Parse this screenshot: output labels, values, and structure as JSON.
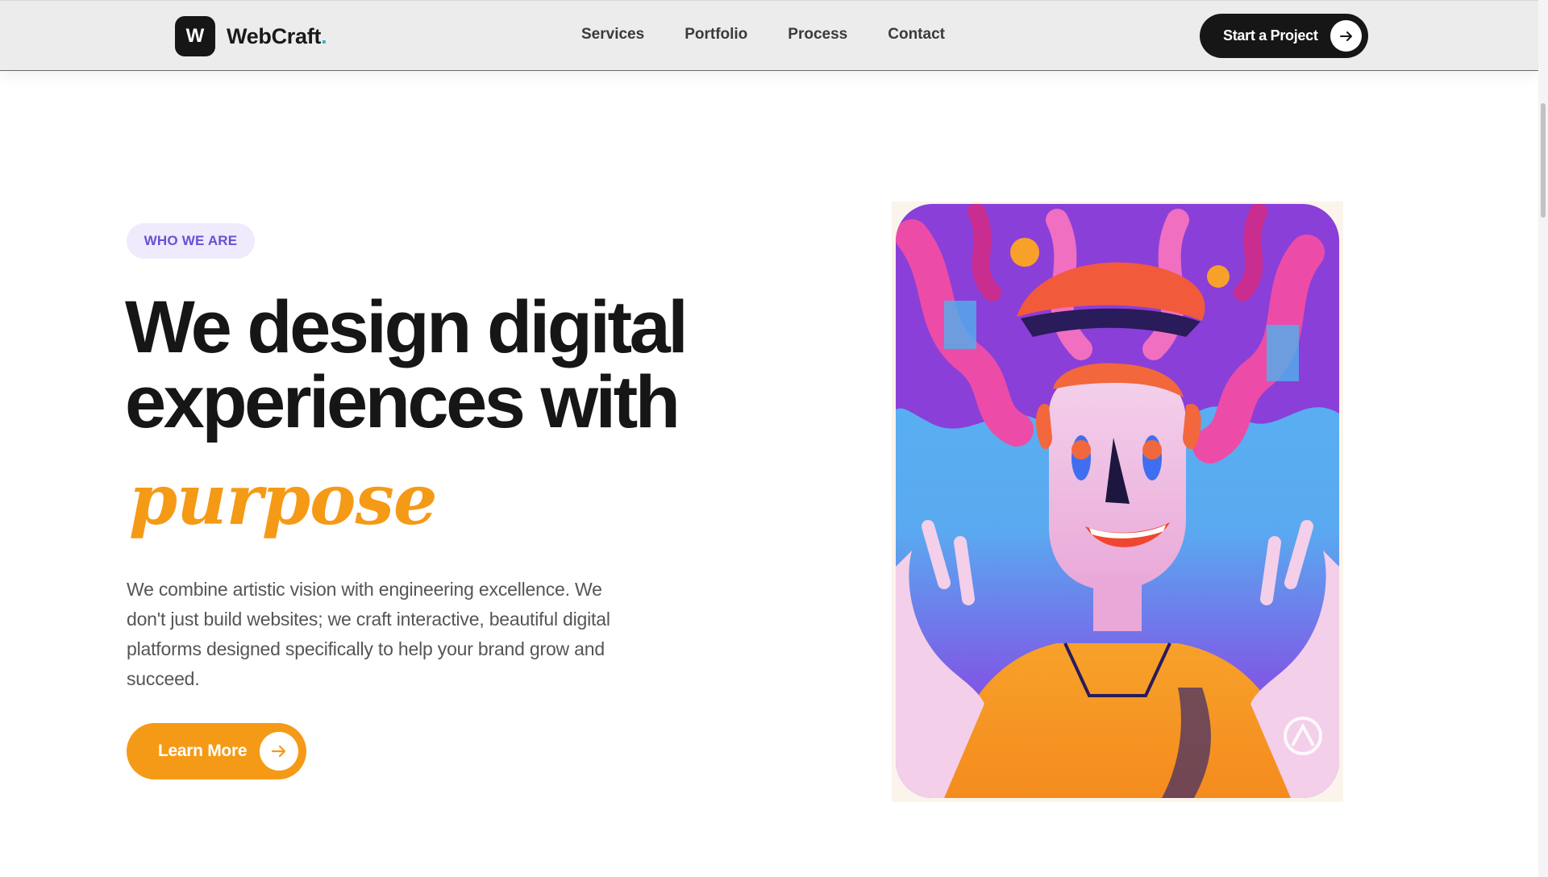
{
  "header": {
    "logo_mark": "W",
    "logo_text": "WebCraft",
    "logo_dot": ".",
    "nav": [
      {
        "label": "Services"
      },
      {
        "label": "Portfolio"
      },
      {
        "label": "Process"
      },
      {
        "label": "Contact"
      }
    ],
    "cta_label": "Start a Project",
    "cta_icon": "arrow-right-icon"
  },
  "hero": {
    "eyebrow": "WHO WE ARE",
    "headline_line1": "We design digital",
    "headline_line2": "experiences with",
    "accent_word": "purpose",
    "body": "We combine artistic vision with engineering excellence. We don't just build websites; we craft interactive, beautiful digital platforms designed specifically to help your brand grow and succeed.",
    "button_label": "Learn More",
    "button_icon": "arrow-right-icon"
  },
  "colors": {
    "accent_orange": "#f59a16",
    "eyebrow_purple": "#6b4fd3",
    "eyebrow_bg": "#efeafc",
    "dark": "#161616",
    "logo_dot": "#2bb3c9"
  }
}
